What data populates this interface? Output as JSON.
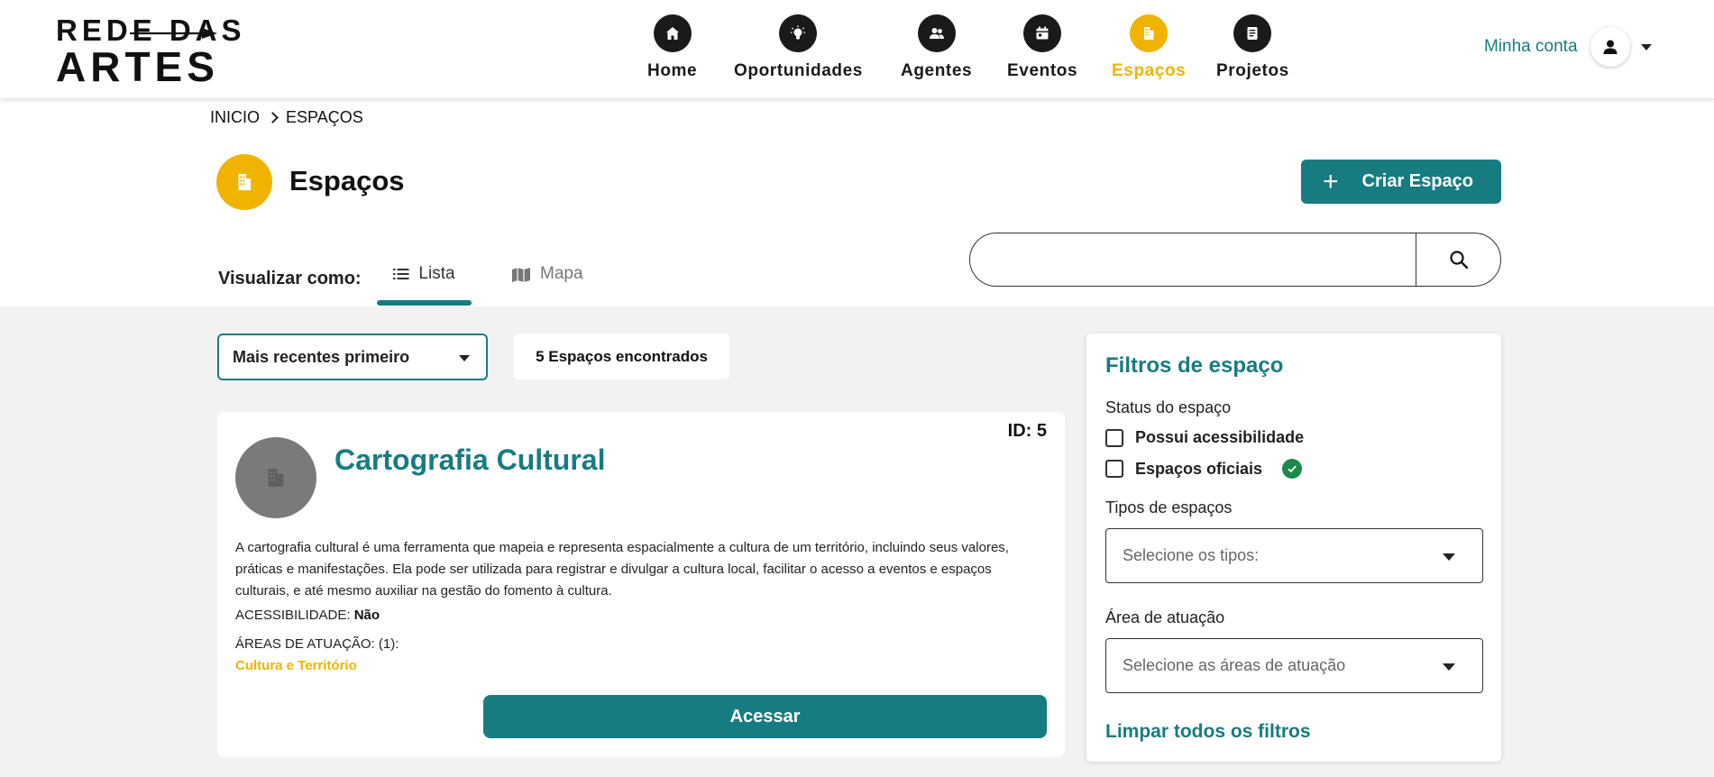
{
  "logo": {
    "line1": "REDE DAS",
    "line2": "ARTES"
  },
  "nav": [
    {
      "label": "Home",
      "icon": "home-icon"
    },
    {
      "label": "Oportunidades",
      "icon": "lightbulb-icon"
    },
    {
      "label": "Agentes",
      "icon": "users-icon"
    },
    {
      "label": "Eventos",
      "icon": "calendar-icon"
    },
    {
      "label": "Espaços",
      "icon": "building-icon",
      "active": true
    },
    {
      "label": "Projetos",
      "icon": "document-icon"
    }
  ],
  "account": {
    "label": "Minha conta"
  },
  "breadcrumb": {
    "home": "INICIO",
    "current": "ESPAÇOS"
  },
  "page": {
    "title": "Espaços",
    "create_label": "Criar Espaço"
  },
  "search": {
    "value": "",
    "placeholder": ""
  },
  "view": {
    "label": "Visualizar como:",
    "list_label": "Lista",
    "map_label": "Mapa",
    "active": "list"
  },
  "sort": {
    "selected": "Mais recentes primeiro"
  },
  "results": {
    "count_label": "5 Espaços encontrados"
  },
  "card": {
    "id_label": "ID: 5",
    "name": "Cartografia Cultural",
    "description": "A cartografia cultural é uma ferramenta que mapeia e representa espacialmente a cultura de um território, incluindo seus valores, práticas e manifestações. Ela pode ser utilizada para registrar e divulgar a cultura local, facilitar o acesso a eventos e espaços culturais, e até mesmo auxiliar na gestão do fomento à cultura.",
    "accessibility_label": "ACESSIBILIDADE:",
    "accessibility_value": "Não",
    "areas_label": "ÁREAS DE ATUAÇÃO: (1):",
    "area_tag": "Cultura e Território",
    "access_label": "Acessar"
  },
  "filters": {
    "title": "Filtros de espaço",
    "status_label": "Status do espaço",
    "accessibility_option": "Possui acessibilidade",
    "official_option": "Espaços oficiais",
    "types_label": "Tipos de espaços",
    "types_placeholder": "Selecione os tipos:",
    "area_label": "Área de atuação",
    "area_placeholder": "Selecione as áreas de atuação",
    "clear_label": "Limpar todos os filtros"
  },
  "colors": {
    "teal": "#177c82",
    "yellow": "#f0b400",
    "dark": "#1a1a1a",
    "check_green": "#1a8a4a",
    "background": "#f2f2f2"
  }
}
